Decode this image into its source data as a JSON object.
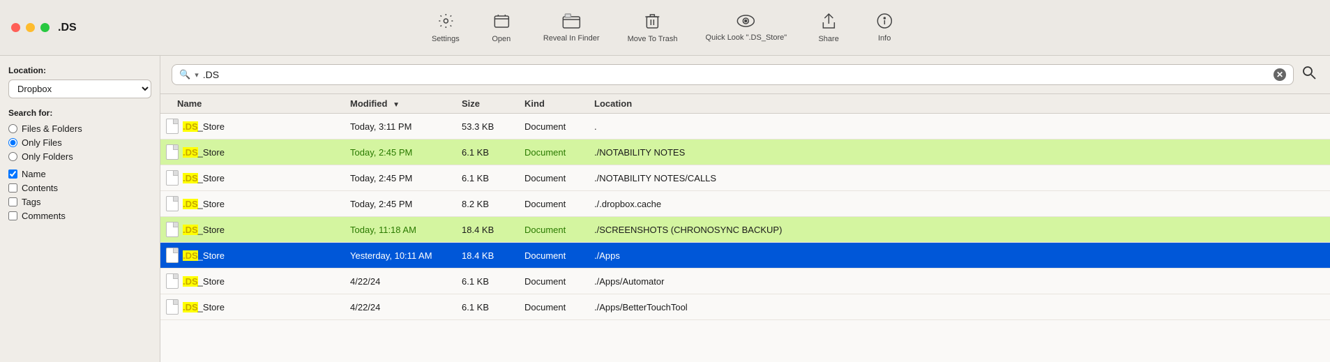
{
  "window": {
    "title": ".DS"
  },
  "toolbar": {
    "buttons": [
      {
        "id": "settings",
        "icon": "⚙",
        "label": "Settings"
      },
      {
        "id": "open",
        "icon": "🗂",
        "label": "Open"
      },
      {
        "id": "reveal-in-finder",
        "icon": "⬛",
        "label": "Reveal In Finder"
      },
      {
        "id": "move-to-trash",
        "icon": "🗑",
        "label": "Move To Trash"
      },
      {
        "id": "quick-look",
        "icon": "👁",
        "label": "Quick Look \".DS_Store\""
      },
      {
        "id": "share",
        "icon": "⬆",
        "label": "Share"
      },
      {
        "id": "info",
        "icon": "ℹ",
        "label": "Info"
      }
    ]
  },
  "sidebar": {
    "location_label": "Location:",
    "location_options": [
      "Dropbox"
    ],
    "location_selected": "Dropbox",
    "search_for_label": "Search for:",
    "radio_options": [
      {
        "id": "files-folders",
        "label": "Files & Folders",
        "checked": false
      },
      {
        "id": "only-files",
        "label": "Only Files",
        "checked": true
      },
      {
        "id": "only-folders",
        "label": "Only Folders",
        "checked": false
      }
    ],
    "checkboxes": [
      {
        "id": "name",
        "label": "Name",
        "checked": true
      },
      {
        "id": "contents",
        "label": "Contents",
        "checked": false
      },
      {
        "id": "tags",
        "label": "Tags",
        "checked": false
      },
      {
        "id": "comments",
        "label": "Comments",
        "checked": false
      }
    ]
  },
  "search": {
    "value": ".DS",
    "placeholder": ""
  },
  "table": {
    "columns": [
      "Name",
      "Modified",
      "Size",
      "Kind",
      "Location"
    ],
    "rows": [
      {
        "name_prefix": ".DS",
        "name_suffix": "_Store",
        "modified": "Today, 3:11 PM",
        "size": "53.3 KB",
        "kind": "Document",
        "location": ".",
        "highlighted": false,
        "selected": false
      },
      {
        "name_prefix": ".DS",
        "name_suffix": "_Store",
        "modified": "Today, 2:45 PM",
        "size": "6.1 KB",
        "kind": "Document",
        "location": "./NOTABILITY NOTES",
        "highlighted": true,
        "selected": false
      },
      {
        "name_prefix": ".DS",
        "name_suffix": "_Store",
        "modified": "Today, 2:45 PM",
        "size": "6.1 KB",
        "kind": "Document",
        "location": "./NOTABILITY NOTES/CALLS",
        "highlighted": false,
        "selected": false
      },
      {
        "name_prefix": ".DS",
        "name_suffix": "_Store",
        "modified": "Today, 2:45 PM",
        "size": "8.2 KB",
        "kind": "Document",
        "location": "./.dropbox.cache",
        "highlighted": false,
        "selected": false
      },
      {
        "name_prefix": ".DS",
        "name_suffix": "_Store",
        "modified": "Today, 11:18 AM",
        "size": "18.4 KB",
        "kind": "Document",
        "location": "./SCREENSHOTS (CHRONOSYNC BACKUP)",
        "highlighted": true,
        "selected": false
      },
      {
        "name_prefix": ".DS",
        "name_suffix": "_Store",
        "modified": "Yesterday, 10:11 AM",
        "size": "18.4 KB",
        "kind": "Document",
        "location": "./Apps",
        "highlighted": false,
        "selected": true
      },
      {
        "name_prefix": ".DS",
        "name_suffix": "_Store",
        "modified": "4/22/24",
        "size": "6.1 KB",
        "kind": "Document",
        "location": "./Apps/Automator",
        "highlighted": false,
        "selected": false
      },
      {
        "name_prefix": ".DS",
        "name_suffix": "_Store",
        "modified": "4/22/24",
        "size": "6.1 KB",
        "kind": "Document",
        "location": "./Apps/BetterTouchTool",
        "highlighted": false,
        "selected": false
      }
    ]
  }
}
